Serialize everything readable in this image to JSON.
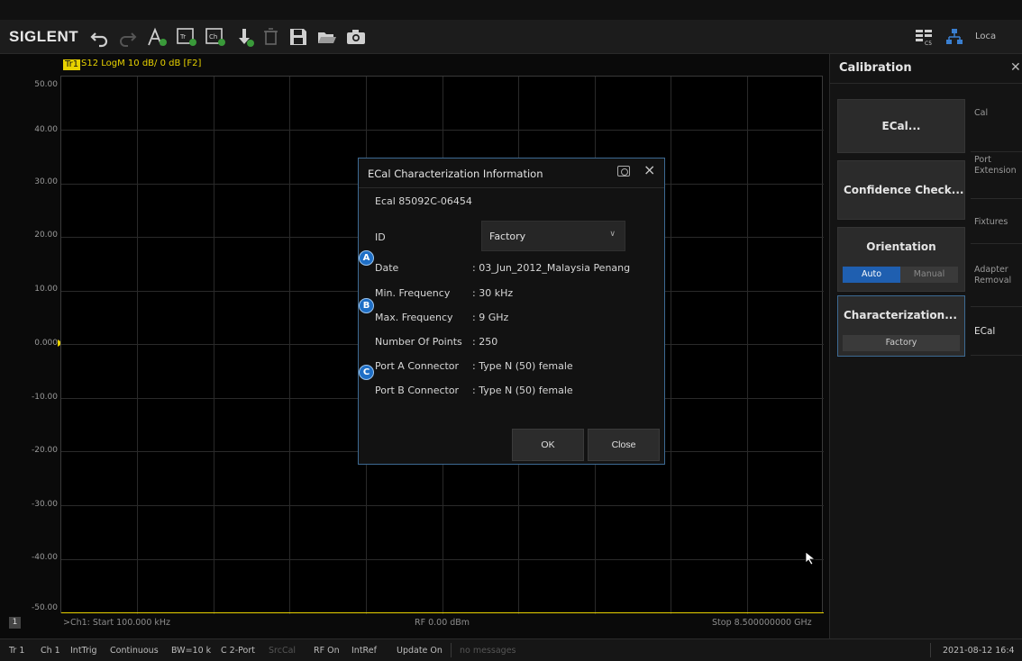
{
  "brand": "SIGLENT",
  "toolbar_icons": [
    "undo-icon",
    "redo-icon",
    "marker-icon",
    "trace-add-icon",
    "channel-add-icon",
    "marker-add-icon",
    "delete-icon",
    "save-icon",
    "open-icon",
    "camera-icon"
  ],
  "toolbar_right": {
    "layout_icon": "layout-icon",
    "network_icon": "network-icon",
    "local_label": "Loca"
  },
  "trace": {
    "tag": "Tr1",
    "title": "S12 LogM 10 dB/ 0 dB [F2]",
    "color": "#e8d200"
  },
  "y_axis": {
    "labels": [
      "50.00",
      "40.00",
      "30.00",
      "20.00",
      "10.00",
      "0.000",
      "-10.00",
      "-20.00",
      "-30.00",
      "-40.00",
      "-50.00"
    ]
  },
  "footer": {
    "channel_badge": "1",
    "start": ">Ch1: Start 100.000 kHz",
    "power": "RF 0.00 dBm",
    "stop": "Stop 8.500000000 GHz"
  },
  "status_bar": {
    "items": [
      "Tr 1",
      "Ch 1",
      "IntTrig",
      "Continuous",
      "BW=10 k",
      "C 2-Port",
      "SrcCal",
      "RF On",
      "IntRef",
      "Update On",
      "no messages"
    ],
    "datetime": "2021-08-12 16:4"
  },
  "side_panel": {
    "title": "Calibration",
    "buttons": {
      "ecal": "ECal...",
      "confidence": "Confidence Check...",
      "orientation": "Orientation",
      "auto": "Auto",
      "manual": "Manual",
      "characterization": "Characterization...",
      "characterization_value": "Factory"
    },
    "tabs": [
      "Cal",
      "Port Extension",
      "Fixtures",
      "Adapter Removal",
      "ECal"
    ]
  },
  "dialog": {
    "title": "ECal Characterization Information",
    "subtitle": "Ecal  85092C-06454",
    "id_label": "ID",
    "id_value": "Factory",
    "rows": [
      {
        "label": "Date",
        "value": ": 03_Jun_2012_Malaysia Penang"
      },
      {
        "label": "Min. Frequency",
        "value": ": 30 kHz"
      },
      {
        "label": "Max. Frequency",
        "value": ": 9 GHz"
      },
      {
        "label": "Number Of Points",
        "value": ": 250"
      },
      {
        "label": "Port A Connector",
        "value": ": Type N (50) female"
      },
      {
        "label": "Port B Connector",
        "value": ": Type N (50) female"
      }
    ],
    "badges": [
      "A",
      "B",
      "C"
    ],
    "ok": "OK",
    "close": "Close"
  }
}
